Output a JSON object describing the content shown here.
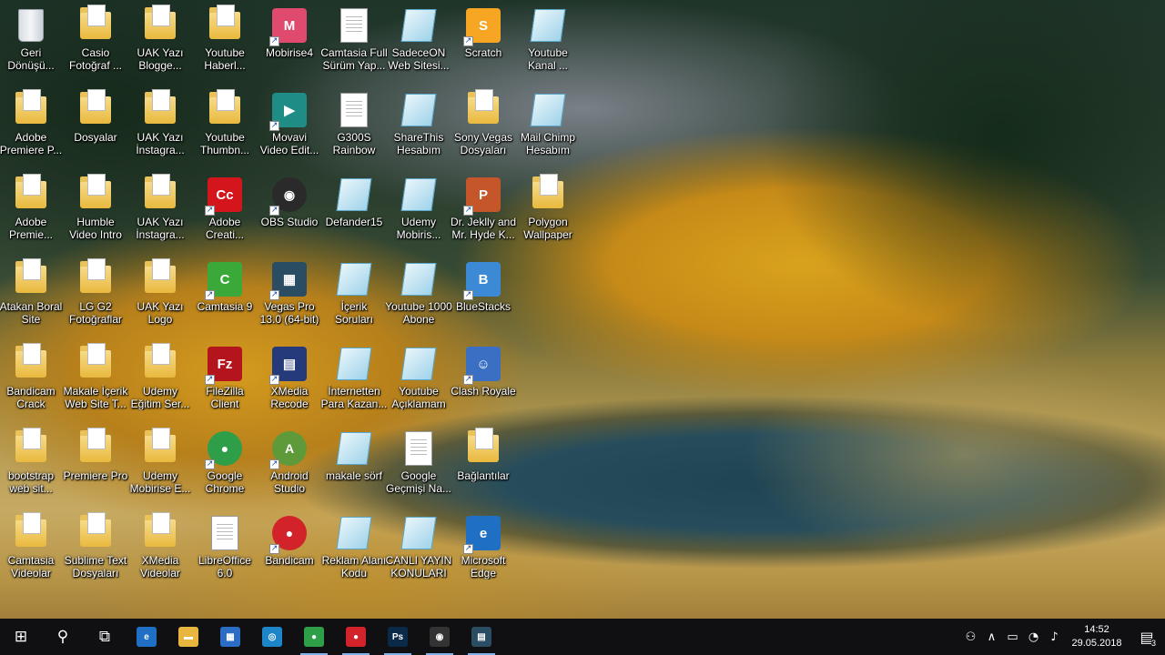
{
  "desktop": {
    "icons": [
      {
        "label": "Geri\nDönüşü...",
        "type": "bin"
      },
      {
        "label": "Adobe\nPremiere P...",
        "type": "folder"
      },
      {
        "label": "Adobe\nPremie...",
        "type": "folder"
      },
      {
        "label": "Atakan Boral\nSite Dosyaları",
        "type": "folder"
      },
      {
        "label": "Bandicam\nCrack",
        "type": "folder"
      },
      {
        "label": "bootstrap\nweb sit...",
        "type": "folder"
      },
      {
        "label": "Camtasia\nVideolar",
        "type": "folder"
      },
      {
        "label": "Casio\nFotoğraf ...",
        "type": "folder"
      },
      {
        "label": "Dosyalar",
        "type": "folder"
      },
      {
        "label": "Humble\nVideo Intro",
        "type": "folder"
      },
      {
        "label": "LG G2\nFotoğraflar",
        "type": "folder"
      },
      {
        "label": "Makale İçerik\nWeb Site T...",
        "type": "folder"
      },
      {
        "label": "Premiere Pro",
        "type": "folder"
      },
      {
        "label": "Sublime Text\nDosyaları",
        "type": "folder"
      },
      {
        "label": "UAK Yazı\nBlogge...",
        "type": "folder"
      },
      {
        "label": "UAK Yazı\nİnstagra...",
        "type": "folder"
      },
      {
        "label": "UAK Yazı\nİnstagra...",
        "type": "folder"
      },
      {
        "label": "UAK Yazı\nLogo",
        "type": "folder"
      },
      {
        "label": "Udemy\nEğitim Ser...",
        "type": "folder"
      },
      {
        "label": "Udemy\nMobirise E...",
        "type": "folder"
      },
      {
        "label": "XMedia\nVideolar",
        "type": "folder"
      },
      {
        "label": "Youtube\nHaberl...",
        "type": "folder"
      },
      {
        "label": "Youtube\nThumbn...",
        "type": "folder"
      },
      {
        "label": "Adobe\nCreati...",
        "type": "app",
        "color": "#d4161c",
        "text": "Cc"
      },
      {
        "label": "Camtasia 9",
        "type": "app",
        "color": "#3aa93a",
        "text": "C"
      },
      {
        "label": "FileZilla\nClient",
        "type": "app",
        "color": "#b4141c",
        "text": "Fz"
      },
      {
        "label": "Google\nChrome",
        "type": "round",
        "color": "#2e9e49",
        "text": "●"
      },
      {
        "label": "LibreOffice\n6.0",
        "type": "doc"
      },
      {
        "label": "Mobirise4",
        "type": "app",
        "color": "#e04a6e",
        "text": "M"
      },
      {
        "label": "Movavi\nVideo Edit...",
        "type": "app",
        "color": "#1f8c86",
        "text": "▶"
      },
      {
        "label": "OBS Studio",
        "type": "round",
        "color": "#2a2a2a",
        "text": "◉"
      },
      {
        "label": "Vegas Pro\n13.0 (64-bit)",
        "type": "app",
        "color": "#2b4d63",
        "text": "▦"
      },
      {
        "label": "XMedia\nRecode",
        "type": "app",
        "color": "#243a7a",
        "text": "▤"
      },
      {
        "label": "Android\nStudio",
        "type": "round",
        "color": "#5f9a3a",
        "text": "A"
      },
      {
        "label": "Bandicam",
        "type": "round",
        "color": "#d2232a",
        "text": "●"
      },
      {
        "label": "Camtasia Full\nSürüm Yap...",
        "type": "doc"
      },
      {
        "label": "G300S\nRainbow",
        "type": "doc"
      },
      {
        "label": "Defander15",
        "type": "note"
      },
      {
        "label": "İçerik Soruları",
        "type": "note"
      },
      {
        "label": "İnternetten\nPara Kazan...",
        "type": "note"
      },
      {
        "label": "makale sörf",
        "type": "note"
      },
      {
        "label": "Reklam Alanı\nKodu",
        "type": "note"
      },
      {
        "label": "SadeceON\nWeb Sitesi...",
        "type": "note"
      },
      {
        "label": "ShareThis\nHesabım",
        "type": "note"
      },
      {
        "label": "Udemy\nMobiris...",
        "type": "note"
      },
      {
        "label": "Youtube 1000\nAbone",
        "type": "note"
      },
      {
        "label": "Youtube\nAçıklamam",
        "type": "note"
      },
      {
        "label": "Google\nGeçmişi Na...",
        "type": "doc"
      },
      {
        "label": "CANLI YAYIN\nKONULARI",
        "type": "note"
      },
      {
        "label": "Scratch",
        "type": "app",
        "color": "#f6a623",
        "text": "S"
      },
      {
        "label": "Sony Vegas\nDosyaları",
        "type": "folder"
      },
      {
        "label": "Dr. Jeklly and\nMr. Hyde K...",
        "type": "app",
        "color": "#c4562a",
        "text": "P"
      },
      {
        "label": "BlueStacks",
        "type": "app",
        "color": "#3c8ad6",
        "text": "B"
      },
      {
        "label": "Clash Royale",
        "type": "app",
        "color": "#3b6fc4",
        "text": "☺"
      },
      {
        "label": "Bağlantılar",
        "type": "folder"
      },
      {
        "label": "Microsoft\nEdge",
        "type": "app",
        "color": "#1f6fc5",
        "text": "e"
      },
      {
        "label": "Youtube\nKanal ...",
        "type": "note"
      },
      {
        "label": "Mail Chimp\nHesabım",
        "type": "note"
      },
      {
        "label": "Polygon\nWallpaper",
        "type": "folder"
      }
    ]
  },
  "taskbar": {
    "start_icon": "⊞",
    "search_icon": "⚲",
    "taskview_icon": "⧉",
    "apps": [
      {
        "name": "edge",
        "text": "e",
        "color": "#1f6fc5"
      },
      {
        "name": "file-explorer",
        "text": "▬",
        "color": "#e8b63e"
      },
      {
        "name": "store",
        "text": "▦",
        "color": "#2b6cc4"
      },
      {
        "name": "movavi",
        "text": "◎",
        "color": "#1c86c8"
      },
      {
        "name": "chrome",
        "text": "●",
        "color": "#2e9e49"
      },
      {
        "name": "bandicam",
        "text": "●",
        "color": "#d2232a"
      },
      {
        "name": "photoshop",
        "text": "Ps",
        "color": "#0b2a4a"
      },
      {
        "name": "obs",
        "text": "◉",
        "color": "#333333"
      },
      {
        "name": "vegas",
        "text": "▤",
        "color": "#2b4d63"
      }
    ],
    "tray": {
      "people_icon": "⚇",
      "chevron_icon": "∧",
      "battery_icon": "▭",
      "network_icon": "◔",
      "volume_icon": "♪",
      "time": "14:52",
      "date": "29.05.2018",
      "notification_icon": "▤",
      "notification_count": "3"
    }
  }
}
